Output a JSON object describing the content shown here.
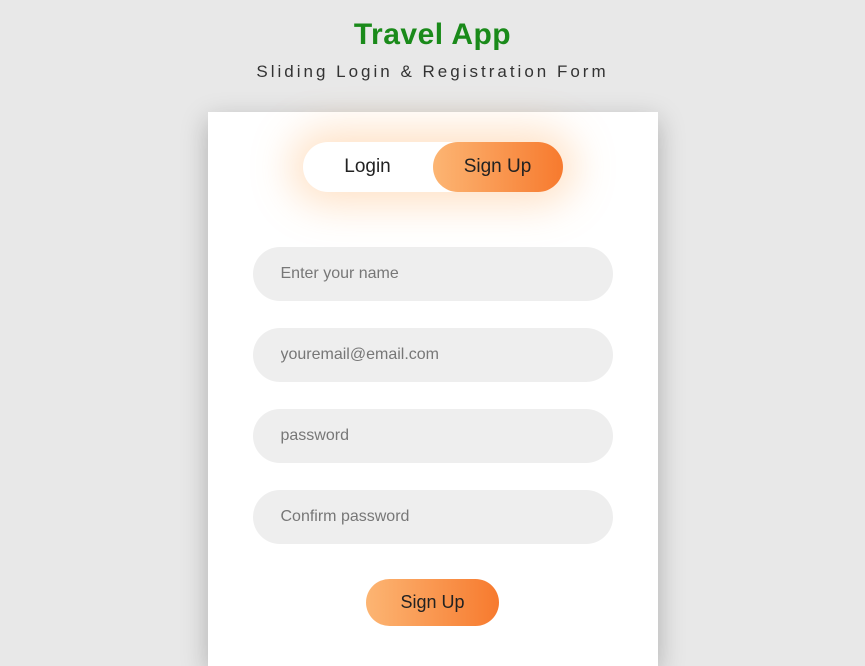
{
  "header": {
    "title": "Travel App",
    "subtitle": "Sliding Login & Registration Form"
  },
  "toggle": {
    "login": "Login",
    "signup": "Sign Up",
    "active": "signup"
  },
  "form": {
    "name_placeholder": "Enter your name",
    "email_placeholder": "youremail@email.com",
    "password_placeholder": "password",
    "confirm_placeholder": "Confirm password",
    "submit_label": "Sign Up"
  },
  "colors": {
    "brand_green": "#1a8a1a",
    "accent_gradient_start": "#fcb573",
    "accent_gradient_end": "#f77a2e",
    "bg": "#e8e8e8",
    "card_bg": "#ffffff",
    "input_bg": "#eeeeee"
  }
}
